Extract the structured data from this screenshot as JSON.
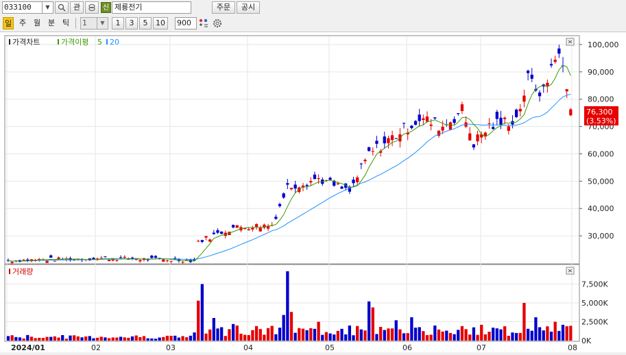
{
  "toolbar": {
    "stock_code": "033100",
    "btn_watch": "관",
    "badge": "신",
    "stock_name": "제룡전기",
    "btn_order": "주문",
    "btn_disclosure": "공시"
  },
  "period_tabs": [
    {
      "label": "일",
      "active": true
    },
    {
      "label": "주",
      "active": false
    },
    {
      "label": "월",
      "active": false
    },
    {
      "label": "분",
      "active": false
    },
    {
      "label": "틱",
      "active": false
    }
  ],
  "interval": {
    "value": "1",
    "options": [
      "1",
      "3",
      "5",
      "10"
    ]
  },
  "count_value": "900",
  "price_panel": {
    "title": "가격차트",
    "ma_label": "가격이평",
    "ma_short": "5",
    "ma_long": "20",
    "current_price": "76,300",
    "change_pct": "(3.53%)",
    "y_ticks": [
      "100,000",
      "90,000",
      "80,000",
      "70,000",
      "60,000",
      "50,000",
      "40,000",
      "30,000"
    ]
  },
  "volume_panel": {
    "title": "거래량",
    "y_ticks": [
      "7,500K",
      "5,000K",
      "2,500K",
      "0K"
    ]
  },
  "x_axis": {
    "labels": [
      "2024/01",
      "02",
      "03",
      "04",
      "05",
      "06",
      "07",
      "08"
    ]
  },
  "colors": {
    "up": "#e60000",
    "down": "#0000cc",
    "ma_short": "#3a9a00",
    "ma_long": "#1e90ff",
    "grid": "#e6e6e6"
  },
  "chart_data": {
    "type": "candlestick",
    "x_unit": "trading day (2024/01 – 2024/08)",
    "price_ylim": [
      20000,
      103000
    ],
    "volume_ylim_k": [
      0,
      10000
    ],
    "anchors": [
      {
        "month": "2024/01",
        "close": 21000
      },
      {
        "month": "02",
        "close": 21500
      },
      {
        "month": "03",
        "close": 34000
      },
      {
        "month": "04",
        "close": 49000
      },
      {
        "month": "05",
        "close": 70000
      },
      {
        "month": "06",
        "close": 66000
      },
      {
        "month": "07",
        "close": 86000
      },
      {
        "month": "08",
        "close": 76300
      }
    ],
    "peak_close": 98000,
    "last_close": 76300,
    "last_change_pct": 3.53
  }
}
